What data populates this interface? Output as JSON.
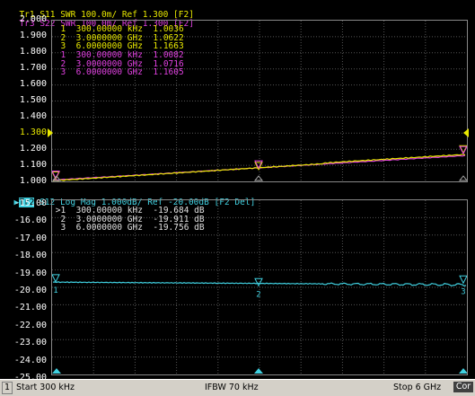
{
  "top": {
    "trace1": "Tr1 S11 SWR 100.0m/ Ref 1.300 [F2]",
    "trace3": "Tr3 S22 SWR 100.0m/ Ref 1.300 [F2]",
    "trace1_color": "#e8e800",
    "trace3_color": "#e040e0",
    "yticks": [
      "2.000",
      "1.900",
      "1.800",
      "1.700",
      "1.600",
      "1.500",
      "1.400",
      "1.300",
      "1.200",
      "1.100",
      "1.000"
    ],
    "ref_value": "1.300",
    "markers_tr1": [
      {
        "num": "1",
        "freq": "300.00000 kHz",
        "val": "1.0036"
      },
      {
        "num": "2",
        "freq": "3.0000000 GHz",
        "val": "1.0622"
      },
      {
        "num": "3",
        "freq": "6.0000000 GHz",
        "val": "1.1663"
      }
    ],
    "markers_tr3": [
      {
        "num": "1",
        "freq": "300.00000 kHz",
        "val": "1.0082"
      },
      {
        "num": "2",
        "freq": "3.0000000 GHz",
        "val": "1.0716"
      },
      {
        "num": "3",
        "freq": "6.0000000 GHz",
        "val": "1.1605"
      }
    ]
  },
  "bottom": {
    "trace_tag": "Tr2",
    "trace2": " S12 Log Mag 1.000dB/ Ref -20.00dB [F2 Del]",
    "trace2_color": "#40d0e0",
    "yticks": [
      "-15.00",
      "-16.00",
      "-17.00",
      "-18.00",
      "-19.00",
      "-20.00",
      "-21.00",
      "-22.00",
      "-23.00",
      "-24.00",
      "-25.00"
    ],
    "markers": [
      {
        "num": ">1",
        "freq": "300.00000 kHz",
        "val": "-19.684 dB"
      },
      {
        "num": "2",
        "freq": "3.0000000 GHz",
        "val": "-19.911 dB"
      },
      {
        "num": "3",
        "freq": "6.0000000 GHz",
        "val": "-19.756 dB"
      }
    ],
    "marker_labels": [
      "1",
      "2",
      "3"
    ]
  },
  "status": {
    "channel": "1",
    "start": "Start 300 kHz",
    "ifbw": "IFBW 70 kHz",
    "stop": "Stop 6 GHz",
    "cor": "Cor"
  }
}
